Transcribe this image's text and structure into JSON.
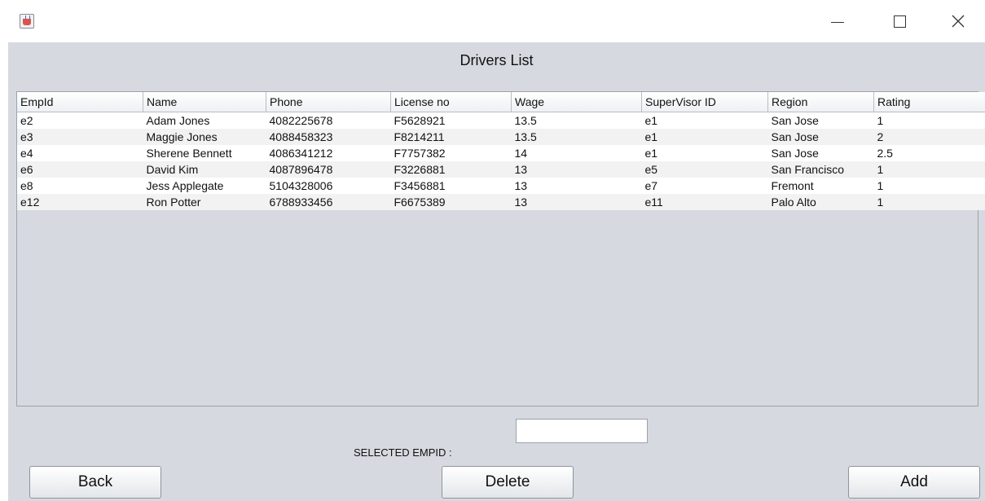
{
  "window": {
    "icon": "java-cup-icon",
    "controls": {
      "minimize": "minimize-icon",
      "maximize": "maximize-icon",
      "close": "close-icon"
    }
  },
  "page": {
    "title": "Drivers List"
  },
  "table": {
    "columns": [
      "EmpId",
      "Name",
      "Phone",
      "License no",
      "Wage",
      "SuperVisor ID",
      "Region",
      "Rating"
    ],
    "rows": [
      [
        "e2",
        "Adam Jones",
        "4082225678",
        "F5628921",
        "13.5",
        "e1",
        "San Jose",
        "1"
      ],
      [
        "e3",
        "Maggie Jones",
        "4088458323",
        "F8214211",
        "13.5",
        "e1",
        "San Jose",
        "2"
      ],
      [
        "e4",
        "Sherene Bennett",
        "4086341212",
        "F7757382",
        "14",
        "e1",
        "San Jose",
        "2.5"
      ],
      [
        "e6",
        "David Kim",
        "4087896478",
        "F3226881",
        "13",
        "e5",
        "San Francisco",
        "1"
      ],
      [
        "e8",
        "Jess Applegate",
        "5104328006",
        "F3456881",
        "13",
        "e7",
        "Fremont",
        "1"
      ],
      [
        "e12",
        "Ron Potter",
        "6788933456",
        "F6675389",
        "13",
        "e11",
        "Palo Alto",
        "1"
      ]
    ]
  },
  "selection": {
    "label": "SELECTED EMPID :",
    "value": ""
  },
  "buttons": {
    "back": "Back",
    "delete": "Delete",
    "add": "Add"
  }
}
